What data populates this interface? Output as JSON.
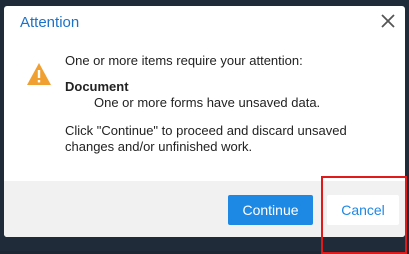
{
  "dialog": {
    "title": "Attention",
    "close_icon": "close-icon",
    "warning_icon": "warning-triangle-icon",
    "intro": "One or more items require your attention:",
    "item_title": "Document",
    "item_detail": "One or more forms have unsaved data.",
    "instructions_line1": "Click \"Continue\" to proceed and discard unsaved",
    "instructions_line2": "changes and/or unfinished work."
  },
  "buttons": {
    "continue_label": "Continue",
    "cancel_label": "Cancel"
  },
  "colors": {
    "title": "#1a73c8",
    "primary_button": "#1e88e5",
    "warning": "#f0a030",
    "highlight_box": "#e0191b"
  }
}
